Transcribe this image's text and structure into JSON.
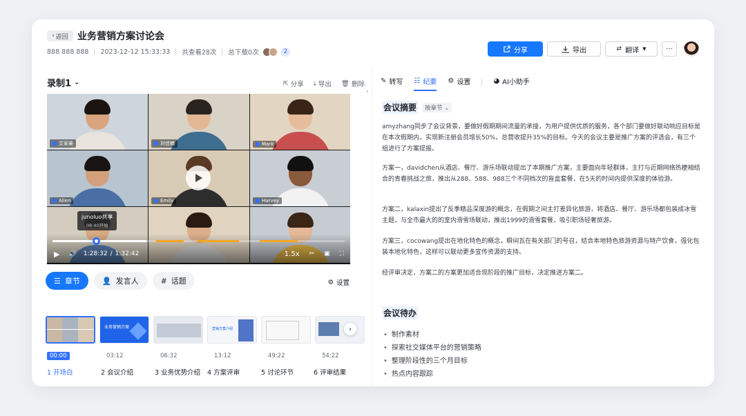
{
  "header": {
    "back_label": "返回",
    "title": "业务营销方案讨论会",
    "meeting_id": "888 888 888",
    "datetime": "2023-12-12 15:33:33",
    "views": "共查看28次",
    "downloads": "总下载0次",
    "viewer_count": "2",
    "share_label": "分享",
    "export_label": "导出",
    "translate_label": "翻译"
  },
  "player": {
    "recording_label": "录制1",
    "share": "分享",
    "export": "导出",
    "delete": "删除",
    "participants": [
      "艾家豪",
      "刘佳楠",
      "Mark",
      "Allen",
      "Emily",
      "Harvey",
      "",
      "",
      ""
    ],
    "tooltip_name": "junoluo共享",
    "tooltip_time": "08:40开始",
    "time_current": "1:28:32",
    "time_total": "1:32:42",
    "speed": "1.5x"
  },
  "tabs": [
    {
      "label": "章节"
    },
    {
      "label": "发言人"
    },
    {
      "label": "话题"
    }
  ],
  "settings_label": "设置",
  "chapters": [
    {
      "time": "00:00",
      "label": "1 开场白"
    },
    {
      "time": "03:12",
      "label": "2 会议介绍"
    },
    {
      "time": "06:32",
      "label": "3 业务优势介绍"
    },
    {
      "time": "13:12",
      "label": "4 方案评审"
    },
    {
      "time": "49:22",
      "label": "5 讨论环节"
    },
    {
      "time": "54:22",
      "label": "6 评审结果"
    }
  ],
  "thumb_titles": [
    "",
    "业务营销方案",
    "",
    "营销方案介绍",
    "",
    ""
  ],
  "right": {
    "tabs": [
      "转写",
      "纪要",
      "设置",
      "AI小助手"
    ],
    "summary_title": "会议摘要",
    "summary_mode": "按章节",
    "paragraphs": [
      "amyzhang同步了会议背景，要做好假期期间流量的承接，为用户提供优质的服务，各个部门要做好联动响应目标是在本次假期内，实现新注册会员增长50%，总营收提升35%的目标。今天的会议主要是推广方案的评选会，有三个组进行了方案提报。",
      "方案一，davidchen从酒店、餐厅、游乐场联动提出了本期推广方案，主要面向年轻群体，主打与近期网络热梗相结合的青春挑战之旅，推出从288、588、988三个不同档次的盲盒套餐，在5天的时间内提供深度的体验游。",
      "方案二，kalaxin提出了反季精品深度游的概念，在假期之间主打差异化旅游，将酒店、餐厅、游乐场都包装成冰雪主题，与全市最大的的室内滑雪场联动，推出1999的滑雪套餐，吸引职场轻奢旅游。",
      "方案三，cocowang提出在地化特色的概念，瞬间瓦在有关部门的号召，结合本地特色旅游资源与特产饮食，强化包装本地化特色，这样可以联动更多宣传资源的支持。",
      "经评审决定，方案二的方案更加适合现阶段的推广目标，决定推进方案二。"
    ],
    "todo_title": "会议待办",
    "todos": [
      "制作素材",
      "探索社交媒体平台的营销策略",
      "整理阶段性的三个月目标",
      "热点内容跟踪"
    ]
  },
  "colors": {
    "accent": "#1677ff"
  }
}
